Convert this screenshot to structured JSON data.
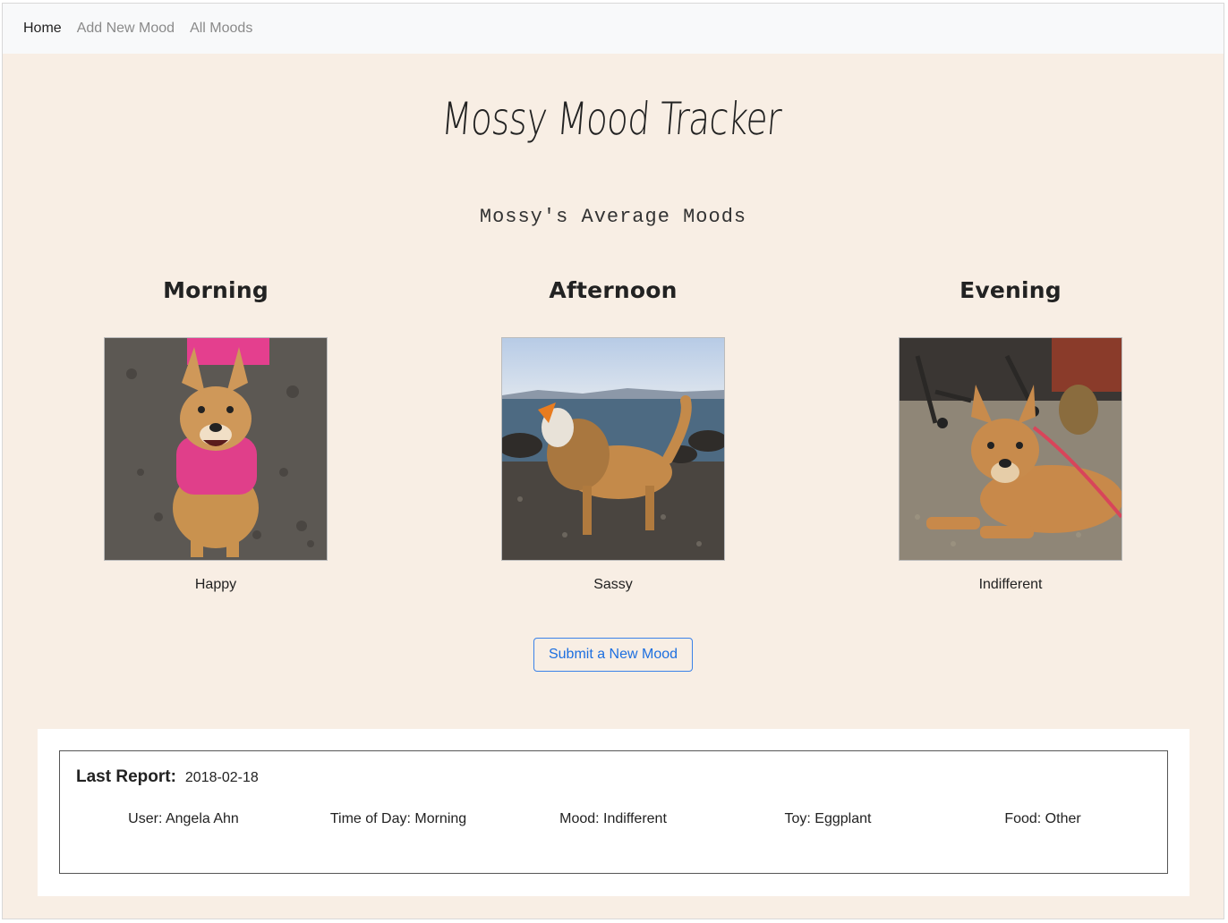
{
  "nav": {
    "items": [
      {
        "label": "Home",
        "active": true
      },
      {
        "label": "Add New Mood",
        "active": false
      },
      {
        "label": "All Moods",
        "active": false
      }
    ]
  },
  "app_title": "Mossy Mood Tracker",
  "section_title": "Mossy's Average Moods",
  "moods": [
    {
      "time": "Morning",
      "mood": "Happy",
      "photo": "dog-on-sand-pink-harness"
    },
    {
      "time": "Afternoon",
      "mood": "Sassy",
      "photo": "dog-lion-mane-beach"
    },
    {
      "time": "Evening",
      "mood": "Indifferent",
      "photo": "dog-lying-office-carpet"
    }
  ],
  "submit_label": "Submit a New Mood",
  "last_report": {
    "label": "Last Report:",
    "date": "2018-02-18",
    "fields": [
      "User: Angela Ahn",
      "Time of Day: Morning",
      "Mood: Indifferent",
      "Toy: Eggplant",
      "Food: Other"
    ]
  },
  "colors": {
    "page_bg": "#f8eee4",
    "navbar_bg": "#f8f9fa",
    "accent": "#1d6fe0"
  }
}
